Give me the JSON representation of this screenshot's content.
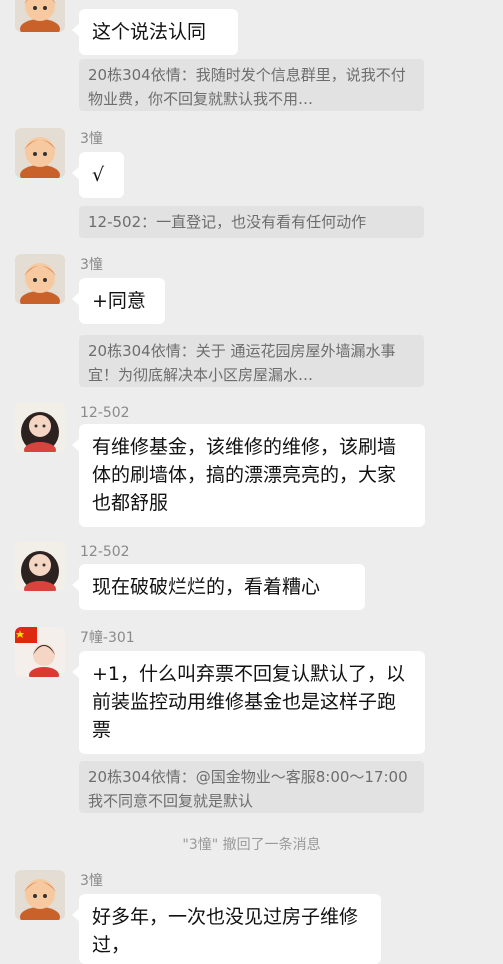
{
  "messages": {
    "m0": {
      "text": "这个说法认同"
    },
    "q0": {
      "text": "20栋304依情：我随时发个信息群里，说我不付物业费，你不回复就默认我不用…"
    },
    "m1": {
      "sender": "3憧",
      "text": "√"
    },
    "q1": {
      "text": "12-502：一直登记，也没有看有任何动作"
    },
    "m2": {
      "sender": "3憧",
      "text": "+同意"
    },
    "q2": {
      "text": "20栋304依情：关于 通运花园房屋外墙漏水事宜！为彻底解决本小区房屋漏水…"
    },
    "m3": {
      "sender": "12-502",
      "text": "有维修基金，该维修的维修，该刷墙体的刷墙体，搞的漂漂亮亮的，大家也都舒服"
    },
    "m4": {
      "sender": "12-502",
      "text": "现在破破烂烂的，看着糟心"
    },
    "m5": {
      "sender": "7幢-301",
      "text": "+1，什么叫弃票不回复认默认了，以前装监控动用维修基金也是这样子跑票"
    },
    "q5": {
      "text": "20栋304依情：@国金物业～客服8:00～17:00 我不同意不回复就是默认"
    },
    "sys": {
      "text": "\"3憧\" 撤回了一条消息"
    },
    "m6": {
      "sender": "3憧",
      "text": "好多年，一次也没见过房子维修过，"
    }
  },
  "colors": {
    "background": "#ededed",
    "bubble": "#ffffff",
    "quote": "#e2e2e2"
  }
}
